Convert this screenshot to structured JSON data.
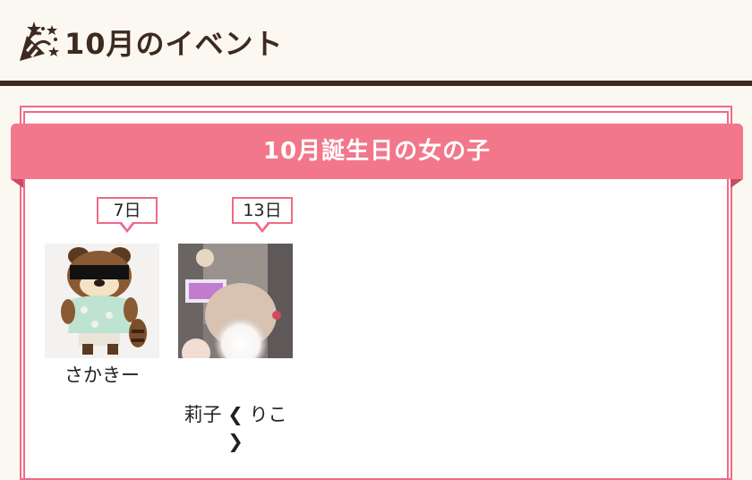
{
  "header": {
    "title": "10月のイベント",
    "icon": "party-popper-icon"
  },
  "birthday_section": {
    "title": "10月誕生日の女の子",
    "girls": [
      {
        "date": "7日",
        "name": "さかきー"
      },
      {
        "date": "13日",
        "name_line1": "莉子 ❮ りこ",
        "name_line2": "❯"
      }
    ]
  },
  "colors": {
    "header_text": "#3d2a1f",
    "header_rule": "#3c2a20",
    "ribbon": "#f2778a",
    "border": "#ee6b86",
    "background": "#fbf8f1"
  }
}
